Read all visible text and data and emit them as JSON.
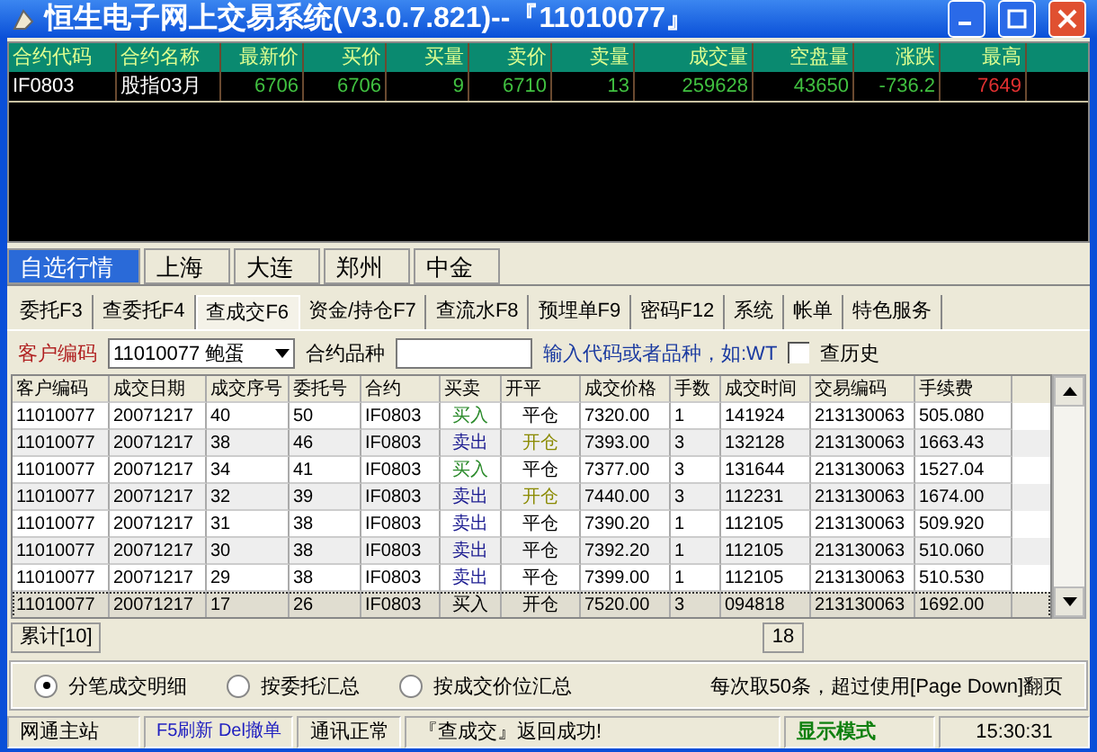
{
  "window": {
    "title": "恒生电子网上交易系统(V3.0.7.821)--『11010077』"
  },
  "quote": {
    "columns": [
      "合约代码",
      "合约名称",
      "最新价",
      "买价",
      "买量",
      "卖价",
      "卖量",
      "成交量",
      "空盘量",
      "涨跌",
      "最高"
    ],
    "rows": [
      {
        "cells": [
          "IF0803",
          "股指03月",
          "6706",
          "6706",
          "9",
          "6710",
          "13",
          "259628",
          "43650",
          "-736.2",
          "7649"
        ]
      }
    ]
  },
  "market_tabs": [
    {
      "label": "自选行情",
      "selected": true
    },
    {
      "label": "上海",
      "selected": false
    },
    {
      "label": "大连",
      "selected": false
    },
    {
      "label": "郑州",
      "selected": false
    },
    {
      "label": "中金",
      "selected": false
    }
  ],
  "function_tabs": [
    {
      "label": "委托F3",
      "selected": false
    },
    {
      "label": "查委托F4",
      "selected": false
    },
    {
      "label": "查成交F6",
      "selected": true
    },
    {
      "label": "资金/持仓F7",
      "selected": false
    },
    {
      "label": "查流水F8",
      "selected": false
    },
    {
      "label": "预埋单F9",
      "selected": false
    },
    {
      "label": "密码F12",
      "selected": false
    },
    {
      "label": "系统",
      "selected": false
    },
    {
      "label": "帐单",
      "selected": false
    },
    {
      "label": "特色服务",
      "selected": false
    }
  ],
  "filter": {
    "customer_label": "客户编码",
    "customer_value": "11010077 鲍蛋",
    "contract_label": "合约品种",
    "hint": "输入代码或者品种，如:WT",
    "history_label": "查历史",
    "history_checked": false
  },
  "table": {
    "columns": [
      "客户编码",
      "成交日期",
      "成交序号",
      "委托号",
      "合约",
      "买卖",
      "开平",
      "成交价格",
      "手数",
      "成交时间",
      "交易编码",
      "手续费"
    ],
    "rows": [
      {
        "selected": false,
        "cells": [
          "11010077",
          "20071217",
          "40",
          "50",
          "IF0803",
          {
            "text": "买入",
            "color": "#2a8a2a"
          },
          {
            "text": "平仓",
            "color": "#000000"
          },
          "7320.00",
          "1",
          "141924",
          "213130063",
          "505.080"
        ]
      },
      {
        "selected": false,
        "cells": [
          "11010077",
          "20071217",
          "38",
          "46",
          "IF0803",
          {
            "text": "卖出",
            "color": "#1a1a90"
          },
          {
            "text": "开仓",
            "color": "#8a8a00"
          },
          "7393.00",
          "3",
          "132128",
          "213130063",
          "1663.43"
        ]
      },
      {
        "selected": false,
        "cells": [
          "11010077",
          "20071217",
          "34",
          "41",
          "IF0803",
          {
            "text": "买入",
            "color": "#2a8a2a"
          },
          {
            "text": "平仓",
            "color": "#000000"
          },
          "7377.00",
          "3",
          "131644",
          "213130063",
          "1527.04"
        ]
      },
      {
        "selected": false,
        "cells": [
          "11010077",
          "20071217",
          "32",
          "39",
          "IF0803",
          {
            "text": "卖出",
            "color": "#1a1a90"
          },
          {
            "text": "开仓",
            "color": "#8a8a00"
          },
          "7440.00",
          "3",
          "112231",
          "213130063",
          "1674.00"
        ]
      },
      {
        "selected": false,
        "cells": [
          "11010077",
          "20071217",
          "31",
          "38",
          "IF0803",
          {
            "text": "卖出",
            "color": "#1a1a90"
          },
          {
            "text": "平仓",
            "color": "#000000"
          },
          "7390.20",
          "1",
          "112105",
          "213130063",
          "509.920"
        ]
      },
      {
        "selected": false,
        "cells": [
          "11010077",
          "20071217",
          "30",
          "38",
          "IF0803",
          {
            "text": "卖出",
            "color": "#1a1a90"
          },
          {
            "text": "平仓",
            "color": "#000000"
          },
          "7392.20",
          "1",
          "112105",
          "213130063",
          "510.060"
        ]
      },
      {
        "selected": false,
        "cells": [
          "11010077",
          "20071217",
          "29",
          "38",
          "IF0803",
          {
            "text": "卖出",
            "color": "#1a1a90"
          },
          {
            "text": "平仓",
            "color": "#000000"
          },
          "7399.00",
          "1",
          "112105",
          "213130063",
          "510.530"
        ]
      },
      {
        "selected": true,
        "cells": [
          "11010077",
          "20071217",
          "17",
          "26",
          "IF0803",
          {
            "text": "买入",
            "color": "#000000"
          },
          {
            "text": "开仓",
            "color": "#000000"
          },
          "7520.00",
          "3",
          "094818",
          "213130063",
          "1692.00"
        ]
      }
    ],
    "total_label": "累计[10]",
    "total_lots": "18"
  },
  "modes": [
    {
      "label": "分笔成交明细",
      "selected": true
    },
    {
      "label": "按委托汇总",
      "selected": false
    },
    {
      "label": "按成交价位汇总",
      "selected": false
    }
  ],
  "paging_note": "每次取50条，超过使用[Page Down]翻页",
  "status_bar": {
    "site": "网通主站",
    "keys": "F5刷新 Del撤单",
    "connection": "通讯正常",
    "message": "『查成交』返回成功!",
    "mode": "显示模式",
    "time": "15:30:31"
  }
}
